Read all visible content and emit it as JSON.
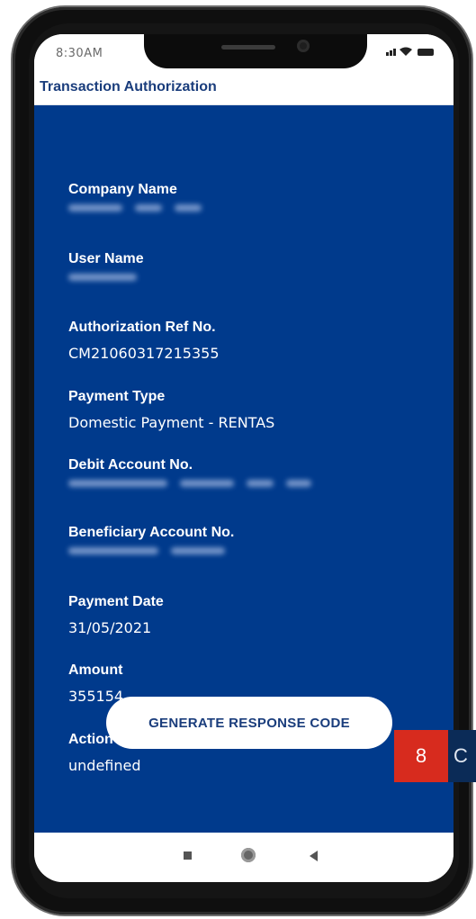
{
  "statusbar": {
    "time": "8:30AM"
  },
  "header": {
    "title": "Transaction Authorization"
  },
  "fields": [
    {
      "label": "Company Name",
      "value": "",
      "redacted": true
    },
    {
      "label": "User Name",
      "value": "",
      "redacted": true
    },
    {
      "label": "Authorization Ref No.",
      "value": "CM21060317215355"
    },
    {
      "label": "Payment Type",
      "value": "Domestic Payment - RENTAS"
    },
    {
      "label": "Debit Account No.",
      "value": "",
      "redacted": true
    },
    {
      "label": "Beneficiary Account No.",
      "value": "",
      "redacted": true
    },
    {
      "label": "Payment Date",
      "value": "31/05/2021"
    },
    {
      "label": "Amount",
      "value": "355154"
    },
    {
      "label": "Action",
      "value": "undefined"
    }
  ],
  "actions": {
    "generate_label": "GENERATE RESPONSE CODE"
  },
  "overlay": {
    "badge_number": "8",
    "badge_tab_text": "C"
  },
  "colors": {
    "primary": "#003a8c",
    "title_text": "#1a3d7c",
    "badge": "#d72b1e"
  },
  "icons": {
    "nav": [
      "recent-apps-icon",
      "home-icon",
      "back-icon"
    ]
  }
}
